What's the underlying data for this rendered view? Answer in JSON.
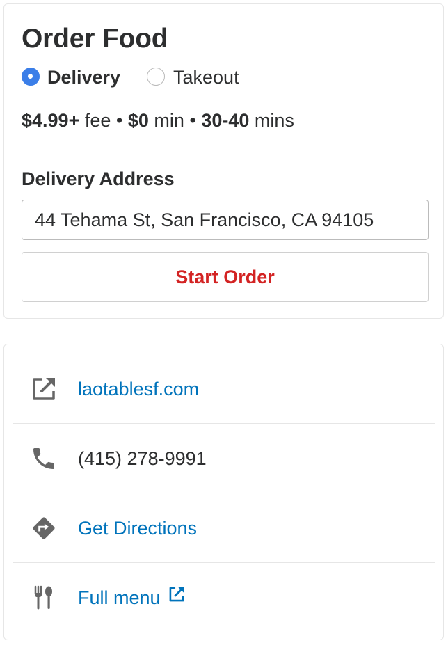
{
  "order": {
    "title": "Order Food",
    "options": [
      {
        "label": "Delivery",
        "selected": true
      },
      {
        "label": "Takeout",
        "selected": false
      }
    ],
    "fee": {
      "fee_value": "$4.99+",
      "fee_word": " fee • ",
      "min_value": "$0",
      "min_word": " min • ",
      "time_value": "30-40",
      "time_word": " mins"
    },
    "address_label": "Delivery Address",
    "address_value": "44 Tehama St, San Francisco, CA 94105",
    "start_button": "Start Order",
    "accent_color": "#3b7ee8",
    "button_text_color": "#d32323"
  },
  "info": {
    "website": {
      "text": "laotablesf.com",
      "icon": "external-link-icon"
    },
    "phone": {
      "text": "(415) 278-9991",
      "icon": "phone-icon"
    },
    "directions": {
      "text": "Get Directions",
      "icon": "directions-icon"
    },
    "menu": {
      "text": "Full menu",
      "icon": "utensils-icon",
      "trailing_icon": "external-link-icon"
    },
    "link_color": "#0073bb"
  }
}
